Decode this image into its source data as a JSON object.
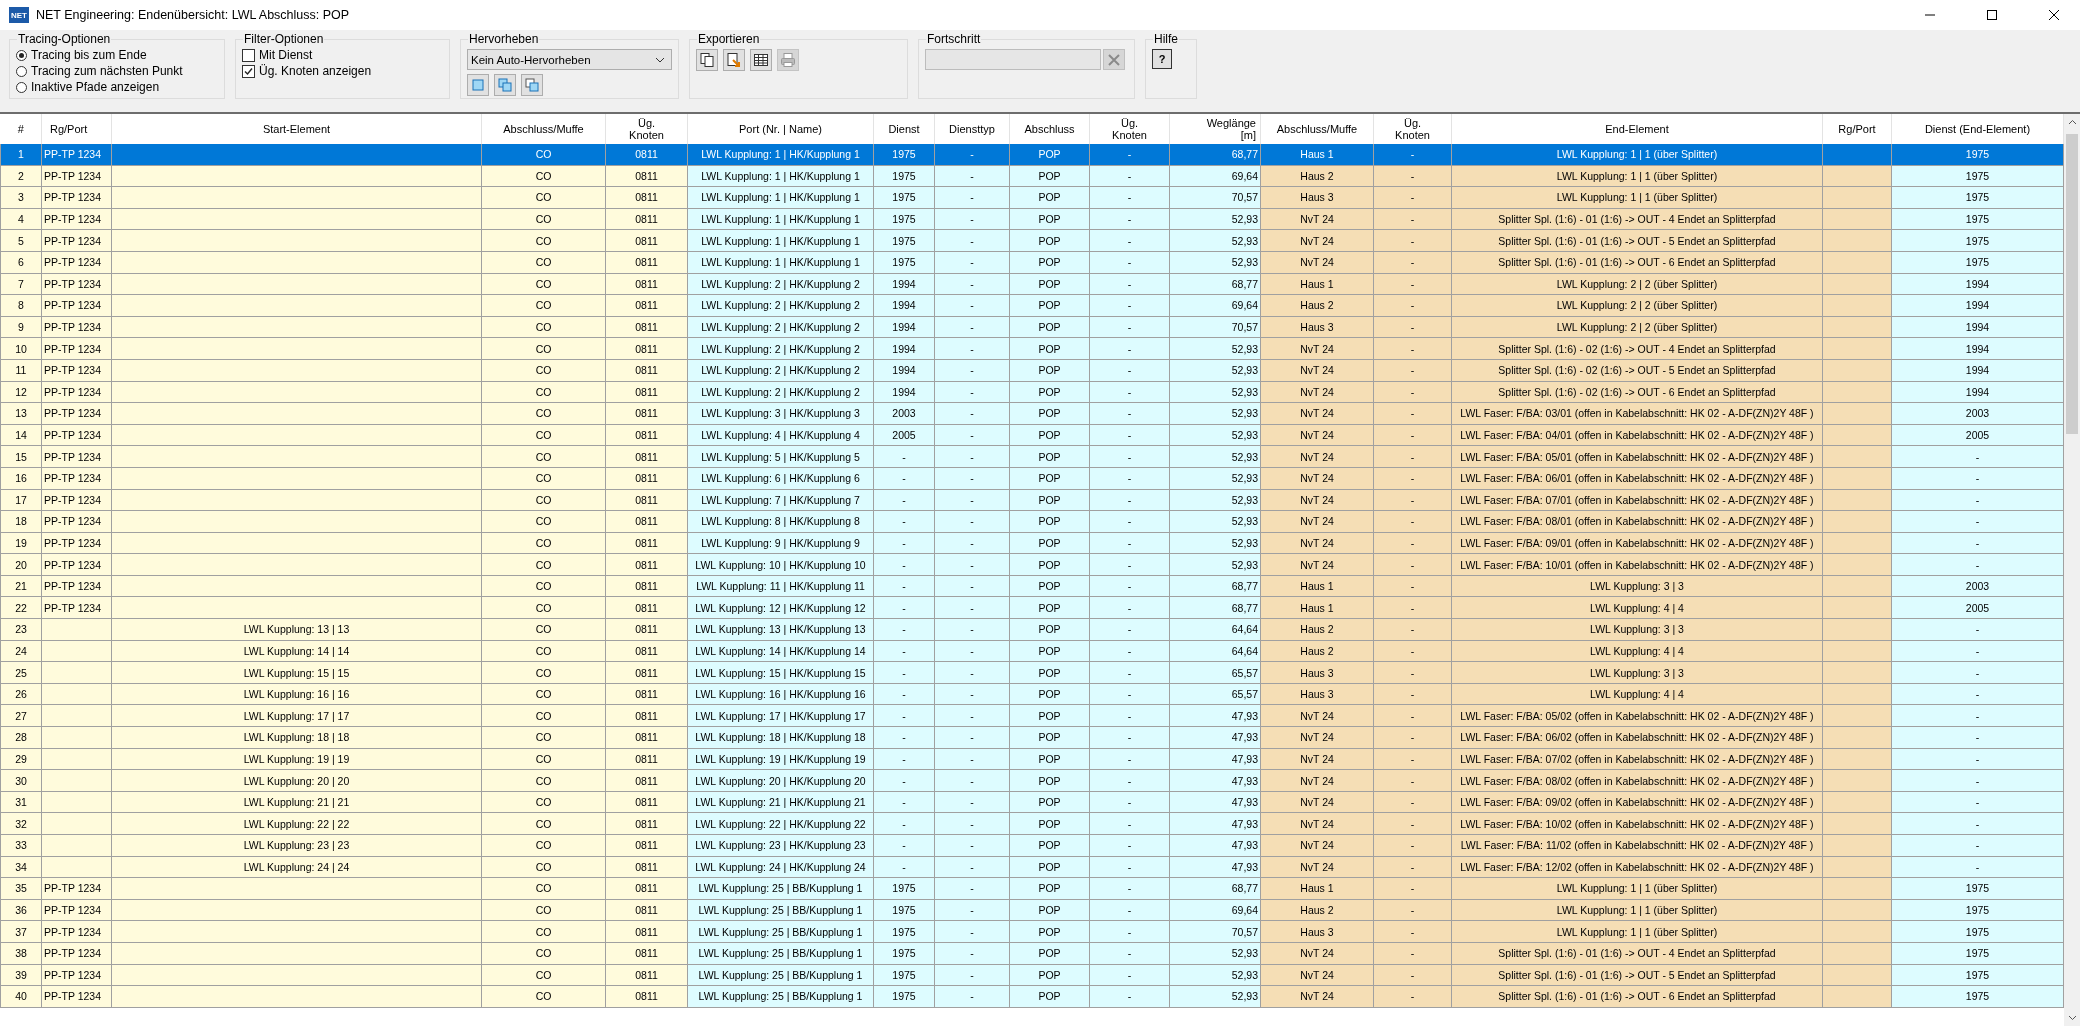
{
  "window": {
    "app_icon_text": "NET",
    "title": "NET Engineering: Endenübersicht: LWL Abschluss: POP"
  },
  "toolbar": {
    "tracing": {
      "title": "Tracing-Optionen",
      "options": [
        {
          "label": "Tracing bis zum Ende",
          "selected": true
        },
        {
          "label": "Tracing zum nächsten Punkt",
          "selected": false
        },
        {
          "label": "Inaktive Pfade anzeigen",
          "selected": false
        }
      ]
    },
    "filter": {
      "title": "Filter-Optionen",
      "options": [
        {
          "label": "Mit Dienst",
          "checked": false
        },
        {
          "label": "Üg. Knoten anzeigen",
          "checked": true
        }
      ]
    },
    "highlight": {
      "title": "Hervorheben",
      "dropdown": "Kein Auto-Hervorheben",
      "buttons": [
        {
          "disabled": false
        },
        {
          "disabled": false
        },
        {
          "disabled": false
        }
      ]
    },
    "export": {
      "title": "Exportieren",
      "buttons": [
        {
          "kind": "copy",
          "disabled": false
        },
        {
          "kind": "export",
          "disabled": false
        },
        {
          "kind": "table",
          "disabled": false
        },
        {
          "kind": "print",
          "disabled": true
        }
      ]
    },
    "progress": {
      "title": "Fortschritt",
      "level": 0,
      "cancel_disabled": true
    },
    "help": {
      "title": "Hilfe",
      "button": "?"
    }
  },
  "table": {
    "columns": [
      {
        "label": "#",
        "color": "#fffbdc"
      },
      {
        "label": "Rg/Port",
        "color": "#fffbdc"
      },
      {
        "label": "Start-Element",
        "color": "#fffbdc"
      },
      {
        "label": "Abschluss/Muffe",
        "color": "#fffbdc"
      },
      {
        "label": "Üg.\nKnoten",
        "color": "#fffbdc"
      },
      {
        "label": "Port (Nr. | Name)",
        "color": "#ddfcff"
      },
      {
        "label": "Dienst",
        "color": "#ddfcff"
      },
      {
        "label": "Diensttyp",
        "color": "#ddfcff"
      },
      {
        "label": "Abschluss",
        "color": "#ddfcff"
      },
      {
        "label": "Üg.\nKnoten",
        "color": "#ddfcff"
      },
      {
        "label": "Weglänge\n[m]",
        "color": "#ddfcff"
      },
      {
        "label": "Abschluss/Muffe",
        "color": "#f5deb5"
      },
      {
        "label": "Üg.\nKnoten",
        "color": "#f5deb5"
      },
      {
        "label": "End-Element",
        "color": "#f5deb5"
      },
      {
        "label": "Rg/Port",
        "color": "#f5deb5"
      },
      {
        "label": "Dienst (End-Element)",
        "color": "#ddfcff"
      }
    ],
    "rows": [
      {
        "selected": true,
        "cells": [
          "1",
          "PP-TP 1234",
          null,
          "CO",
          "0811",
          "LWL Kupplung: 1 | HK/Kupplung 1",
          "1975",
          "-",
          "POP",
          "-",
          "68,77",
          "Haus 1",
          "-",
          "LWL Kupplung: 1 | 1 (über Splitter)",
          null,
          "1975"
        ]
      },
      {
        "selected": false,
        "cells": [
          "2",
          "PP-TP 1234",
          null,
          "CO",
          "0811",
          "LWL Kupplung: 1 | HK/Kupplung 1",
          "1975",
          "-",
          "POP",
          "-",
          "69,64",
          "Haus 2",
          "-",
          "LWL Kupplung: 1 | 1 (über Splitter)",
          null,
          "1975"
        ]
      },
      {
        "selected": false,
        "cells": [
          "3",
          "PP-TP 1234",
          null,
          "CO",
          "0811",
          "LWL Kupplung: 1 | HK/Kupplung 1",
          "1975",
          "-",
          "POP",
          "-",
          "70,57",
          "Haus 3",
          "-",
          "LWL Kupplung: 1 | 1 (über Splitter)",
          null,
          "1975"
        ]
      },
      {
        "selected": false,
        "cells": [
          "4",
          "PP-TP 1234",
          null,
          "CO",
          "0811",
          "LWL Kupplung: 1 | HK/Kupplung 1",
          "1975",
          "-",
          "POP",
          "-",
          "52,93",
          "NvT 24",
          "-",
          "Splitter Spl. (1:6) - 01 (1:6) -> OUT - 4 Endet an Splitterpfad",
          null,
          "1975"
        ]
      },
      {
        "selected": false,
        "cells": [
          "5",
          "PP-TP 1234",
          null,
          "CO",
          "0811",
          "LWL Kupplung: 1 | HK/Kupplung 1",
          "1975",
          "-",
          "POP",
          "-",
          "52,93",
          "NvT 24",
          "-",
          "Splitter Spl. (1:6) - 01 (1:6) -> OUT - 5 Endet an Splitterpfad",
          null,
          "1975"
        ]
      },
      {
        "selected": false,
        "cells": [
          "6",
          "PP-TP 1234",
          null,
          "CO",
          "0811",
          "LWL Kupplung: 1 | HK/Kupplung 1",
          "1975",
          "-",
          "POP",
          "-",
          "52,93",
          "NvT 24",
          "-",
          "Splitter Spl. (1:6) - 01 (1:6) -> OUT - 6 Endet an Splitterpfad",
          null,
          "1975"
        ]
      },
      {
        "selected": false,
        "cells": [
          "7",
          "PP-TP 1234",
          null,
          "CO",
          "0811",
          "LWL Kupplung: 2 | HK/Kupplung 2",
          "1994",
          "-",
          "POP",
          "-",
          "68,77",
          "Haus 1",
          "-",
          "LWL Kupplung: 2 | 2 (über Splitter)",
          null,
          "1994"
        ]
      },
      {
        "selected": false,
        "cells": [
          "8",
          "PP-TP 1234",
          null,
          "CO",
          "0811",
          "LWL Kupplung: 2 | HK/Kupplung 2",
          "1994",
          "-",
          "POP",
          "-",
          "69,64",
          "Haus 2",
          "-",
          "LWL Kupplung: 2 | 2 (über Splitter)",
          null,
          "1994"
        ]
      },
      {
        "selected": false,
        "cells": [
          "9",
          "PP-TP 1234",
          null,
          "CO",
          "0811",
          "LWL Kupplung: 2 | HK/Kupplung 2",
          "1994",
          "-",
          "POP",
          "-",
          "70,57",
          "Haus 3",
          "-",
          "LWL Kupplung: 2 | 2 (über Splitter)",
          null,
          "1994"
        ]
      },
      {
        "selected": false,
        "cells": [
          "10",
          "PP-TP 1234",
          null,
          "CO",
          "0811",
          "LWL Kupplung: 2 | HK/Kupplung 2",
          "1994",
          "-",
          "POP",
          "-",
          "52,93",
          "NvT 24",
          "-",
          "Splitter Spl. (1:6) - 02 (1:6) -> OUT - 4 Endet an Splitterpfad",
          null,
          "1994"
        ]
      },
      {
        "selected": false,
        "cells": [
          "11",
          "PP-TP 1234",
          null,
          "CO",
          "0811",
          "LWL Kupplung: 2 | HK/Kupplung 2",
          "1994",
          "-",
          "POP",
          "-",
          "52,93",
          "NvT 24",
          "-",
          "Splitter Spl. (1:6) - 02 (1:6) -> OUT - 5 Endet an Splitterpfad",
          null,
          "1994"
        ]
      },
      {
        "selected": false,
        "cells": [
          "12",
          "PP-TP 1234",
          null,
          "CO",
          "0811",
          "LWL Kupplung: 2 | HK/Kupplung 2",
          "1994",
          "-",
          "POP",
          "-",
          "52,93",
          "NvT 24",
          "-",
          "Splitter Spl. (1:6) - 02 (1:6) -> OUT - 6 Endet an Splitterpfad",
          null,
          "1994"
        ]
      },
      {
        "selected": false,
        "cells": [
          "13",
          "PP-TP 1234",
          null,
          "CO",
          "0811",
          "LWL Kupplung: 3 | HK/Kupplung 3",
          "2003",
          "-",
          "POP",
          "-",
          "52,93",
          "NvT 24",
          "-",
          "LWL Faser: F/BA: 03/01 (offen in Kabelabschnitt: HK 02 - A-DF(ZN)2Y 48F )",
          null,
          "2003"
        ]
      },
      {
        "selected": false,
        "cells": [
          "14",
          "PP-TP 1234",
          null,
          "CO",
          "0811",
          "LWL Kupplung: 4 | HK/Kupplung 4",
          "2005",
          "-",
          "POP",
          "-",
          "52,93",
          "NvT 24",
          "-",
          "LWL Faser: F/BA: 04/01 (offen in Kabelabschnitt: HK 02 - A-DF(ZN)2Y 48F )",
          null,
          "2005"
        ]
      },
      {
        "selected": false,
        "cells": [
          "15",
          "PP-TP 1234",
          null,
          "CO",
          "0811",
          "LWL Kupplung: 5 | HK/Kupplung 5",
          "-",
          "-",
          "POP",
          "-",
          "52,93",
          "NvT 24",
          "-",
          "LWL Faser: F/BA: 05/01 (offen in Kabelabschnitt: HK 02 - A-DF(ZN)2Y 48F )",
          null,
          "-"
        ]
      },
      {
        "selected": false,
        "cells": [
          "16",
          "PP-TP 1234",
          null,
          "CO",
          "0811",
          "LWL Kupplung: 6 | HK/Kupplung 6",
          "-",
          "-",
          "POP",
          "-",
          "52,93",
          "NvT 24",
          "-",
          "LWL Faser: F/BA: 06/01 (offen in Kabelabschnitt: HK 02 - A-DF(ZN)2Y 48F )",
          null,
          "-"
        ]
      },
      {
        "selected": false,
        "cells": [
          "17",
          "PP-TP 1234",
          null,
          "CO",
          "0811",
          "LWL Kupplung: 7 | HK/Kupplung 7",
          "-",
          "-",
          "POP",
          "-",
          "52,93",
          "NvT 24",
          "-",
          "LWL Faser: F/BA: 07/01 (offen in Kabelabschnitt: HK 02 - A-DF(ZN)2Y 48F )",
          null,
          "-"
        ]
      },
      {
        "selected": false,
        "cells": [
          "18",
          "PP-TP 1234",
          null,
          "CO",
          "0811",
          "LWL Kupplung: 8 | HK/Kupplung 8",
          "-",
          "-",
          "POP",
          "-",
          "52,93",
          "NvT 24",
          "-",
          "LWL Faser: F/BA: 08/01 (offen in Kabelabschnitt: HK 02 - A-DF(ZN)2Y 48F )",
          null,
          "-"
        ]
      },
      {
        "selected": false,
        "cells": [
          "19",
          "PP-TP 1234",
          null,
          "CO",
          "0811",
          "LWL Kupplung: 9 | HK/Kupplung 9",
          "-",
          "-",
          "POP",
          "-",
          "52,93",
          "NvT 24",
          "-",
          "LWL Faser: F/BA: 09/01 (offen in Kabelabschnitt: HK 02 - A-DF(ZN)2Y 48F )",
          null,
          "-"
        ]
      },
      {
        "selected": false,
        "cells": [
          "20",
          "PP-TP 1234",
          null,
          "CO",
          "0811",
          "LWL Kupplung: 10 | HK/Kupplung 10",
          "-",
          "-",
          "POP",
          "-",
          "52,93",
          "NvT 24",
          "-",
          "LWL Faser: F/BA: 10/01 (offen in Kabelabschnitt: HK 02 - A-DF(ZN)2Y 48F )",
          null,
          "-"
        ]
      },
      {
        "selected": false,
        "cells": [
          "21",
          "PP-TP 1234",
          null,
          "CO",
          "0811",
          "LWL Kupplung: 11 | HK/Kupplung 11",
          "-",
          "-",
          "POP",
          "-",
          "68,77",
          "Haus 1",
          "-",
          "LWL Kupplung: 3 | 3",
          null,
          "2003"
        ]
      },
      {
        "selected": false,
        "cells": [
          "22",
          "PP-TP 1234",
          null,
          "CO",
          "0811",
          "LWL Kupplung: 12 | HK/Kupplung 12",
          "-",
          "-",
          "POP",
          "-",
          "68,77",
          "Haus 1",
          "-",
          "LWL Kupplung: 4 | 4",
          null,
          "2005"
        ]
      },
      {
        "selected": false,
        "cells": [
          "23",
          null,
          "LWL Kupplung: 13 | 13",
          "CO",
          "0811",
          "LWL Kupplung: 13 | HK/Kupplung 13",
          "-",
          "-",
          "POP",
          "-",
          "64,64",
          "Haus 2",
          "-",
          "LWL Kupplung: 3 | 3",
          null,
          "-"
        ]
      },
      {
        "selected": false,
        "cells": [
          "24",
          null,
          "LWL Kupplung: 14 | 14",
          "CO",
          "0811",
          "LWL Kupplung: 14 | HK/Kupplung 14",
          "-",
          "-",
          "POP",
          "-",
          "64,64",
          "Haus 2",
          "-",
          "LWL Kupplung: 4 | 4",
          null,
          "-"
        ]
      },
      {
        "selected": false,
        "cells": [
          "25",
          null,
          "LWL Kupplung: 15 | 15",
          "CO",
          "0811",
          "LWL Kupplung: 15 | HK/Kupplung 15",
          "-",
          "-",
          "POP",
          "-",
          "65,57",
          "Haus 3",
          "-",
          "LWL Kupplung: 3 | 3",
          null,
          "-"
        ]
      },
      {
        "selected": false,
        "cells": [
          "26",
          null,
          "LWL Kupplung: 16 | 16",
          "CO",
          "0811",
          "LWL Kupplung: 16 | HK/Kupplung 16",
          "-",
          "-",
          "POP",
          "-",
          "65,57",
          "Haus 3",
          "-",
          "LWL Kupplung: 4 | 4",
          null,
          "-"
        ]
      },
      {
        "selected": false,
        "cells": [
          "27",
          null,
          "LWL Kupplung: 17 | 17",
          "CO",
          "0811",
          "LWL Kupplung: 17 | HK/Kupplung 17",
          "-",
          "-",
          "POP",
          "-",
          "47,93",
          "NvT 24",
          "-",
          "LWL Faser: F/BA: 05/02 (offen in Kabelabschnitt: HK 02 - A-DF(ZN)2Y 48F )",
          null,
          "-"
        ]
      },
      {
        "selected": false,
        "cells": [
          "28",
          null,
          "LWL Kupplung: 18 | 18",
          "CO",
          "0811",
          "LWL Kupplung: 18 | HK/Kupplung 18",
          "-",
          "-",
          "POP",
          "-",
          "47,93",
          "NvT 24",
          "-",
          "LWL Faser: F/BA: 06/02 (offen in Kabelabschnitt: HK 02 - A-DF(ZN)2Y 48F )",
          null,
          "-"
        ]
      },
      {
        "selected": false,
        "cells": [
          "29",
          null,
          "LWL Kupplung: 19 | 19",
          "CO",
          "0811",
          "LWL Kupplung: 19 | HK/Kupplung 19",
          "-",
          "-",
          "POP",
          "-",
          "47,93",
          "NvT 24",
          "-",
          "LWL Faser: F/BA: 07/02 (offen in Kabelabschnitt: HK 02 - A-DF(ZN)2Y 48F )",
          null,
          "-"
        ]
      },
      {
        "selected": false,
        "cells": [
          "30",
          null,
          "LWL Kupplung: 20 | 20",
          "CO",
          "0811",
          "LWL Kupplung: 20 | HK/Kupplung 20",
          "-",
          "-",
          "POP",
          "-",
          "47,93",
          "NvT 24",
          "-",
          "LWL Faser: F/BA: 08/02 (offen in Kabelabschnitt: HK 02 - A-DF(ZN)2Y 48F )",
          null,
          "-"
        ]
      },
      {
        "selected": false,
        "cells": [
          "31",
          null,
          "LWL Kupplung: 21 | 21",
          "CO",
          "0811",
          "LWL Kupplung: 21 | HK/Kupplung 21",
          "-",
          "-",
          "POP",
          "-",
          "47,93",
          "NvT 24",
          "-",
          "LWL Faser: F/BA: 09/02 (offen in Kabelabschnitt: HK 02 - A-DF(ZN)2Y 48F )",
          null,
          "-"
        ]
      },
      {
        "selected": false,
        "cells": [
          "32",
          null,
          "LWL Kupplung: 22 | 22",
          "CO",
          "0811",
          "LWL Kupplung: 22 | HK/Kupplung 22",
          "-",
          "-",
          "POP",
          "-",
          "47,93",
          "NvT 24",
          "-",
          "LWL Faser: F/BA: 10/02 (offen in Kabelabschnitt: HK 02 - A-DF(ZN)2Y 48F )",
          null,
          "-"
        ]
      },
      {
        "selected": false,
        "cells": [
          "33",
          null,
          "LWL Kupplung: 23 | 23",
          "CO",
          "0811",
          "LWL Kupplung: 23 | HK/Kupplung 23",
          "-",
          "-",
          "POP",
          "-",
          "47,93",
          "NvT 24",
          "-",
          "LWL Faser: F/BA: 11/02 (offen in Kabelabschnitt: HK 02 - A-DF(ZN)2Y 48F )",
          null,
          "-"
        ]
      },
      {
        "selected": false,
        "cells": [
          "34",
          null,
          "LWL Kupplung: 24 | 24",
          "CO",
          "0811",
          "LWL Kupplung: 24 | HK/Kupplung 24",
          "-",
          "-",
          "POP",
          "-",
          "47,93",
          "NvT 24",
          "-",
          "LWL Faser: F/BA: 12/02 (offen in Kabelabschnitt: HK 02 - A-DF(ZN)2Y 48F )",
          null,
          "-"
        ]
      },
      {
        "selected": false,
        "cells": [
          "35",
          "PP-TP 1234",
          null,
          "CO",
          "0811",
          "LWL Kupplung: 25 | BB/Kupplung 1",
          "1975",
          "-",
          "POP",
          "-",
          "68,77",
          "Haus 1",
          "-",
          "LWL Kupplung: 1 | 1 (über Splitter)",
          null,
          "1975"
        ]
      },
      {
        "selected": false,
        "cells": [
          "36",
          "PP-TP 1234",
          null,
          "CO",
          "0811",
          "LWL Kupplung: 25 | BB/Kupplung 1",
          "1975",
          "-",
          "POP",
          "-",
          "69,64",
          "Haus 2",
          "-",
          "LWL Kupplung: 1 | 1 (über Splitter)",
          null,
          "1975"
        ]
      },
      {
        "selected": false,
        "cells": [
          "37",
          "PP-TP 1234",
          null,
          "CO",
          "0811",
          "LWL Kupplung: 25 | BB/Kupplung 1",
          "1975",
          "-",
          "POP",
          "-",
          "70,57",
          "Haus 3",
          "-",
          "LWL Kupplung: 1 | 1 (über Splitter)",
          null,
          "1975"
        ]
      },
      {
        "selected": false,
        "cells": [
          "38",
          "PP-TP 1234",
          null,
          "CO",
          "0811",
          "LWL Kupplung: 25 | BB/Kupplung 1",
          "1975",
          "-",
          "POP",
          "-",
          "52,93",
          "NvT 24",
          "-",
          "Splitter Spl. (1:6) - 01 (1:6) -> OUT - 4 Endet an Splitterpfad",
          null,
          "1975"
        ]
      },
      {
        "selected": false,
        "cells": [
          "39",
          "PP-TP 1234",
          null,
          "CO",
          "0811",
          "LWL Kupplung: 25 | BB/Kupplung 1",
          "1975",
          "-",
          "POP",
          "-",
          "52,93",
          "NvT 24",
          "-",
          "Splitter Spl. (1:6) - 01 (1:6) -> OUT - 5 Endet an Splitterpfad",
          null,
          "1975"
        ]
      },
      {
        "selected": false,
        "cells": [
          "40",
          "PP-TP 1234",
          null,
          "CO",
          "0811",
          "LWL Kupplung: 25 | BB/Kupplung 1",
          "1975",
          "-",
          "POP",
          "-",
          "52,93",
          "NvT 24",
          "-",
          "Splitter Spl. (1:6) - 01 (1:6) -> OUT - 6 Endet an Splitterpfad",
          null,
          "1975"
        ]
      }
    ]
  }
}
